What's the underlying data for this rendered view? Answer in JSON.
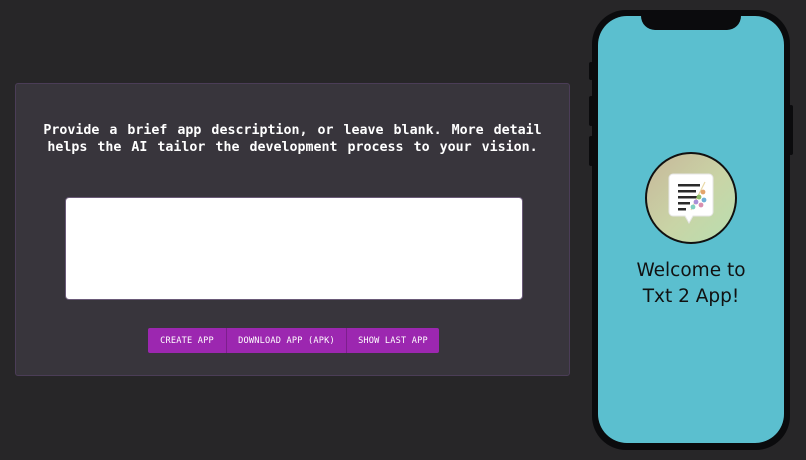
{
  "form": {
    "instructions": "Provide a brief app description, or leave blank. More detail\nhelps the AI tailor the development process to your vision.",
    "description_value": "",
    "description_placeholder": ""
  },
  "buttons": {
    "create": "CREATE APP",
    "download": "DOWNLOAD APP (APK)",
    "show_last": "SHOW LAST APP"
  },
  "phone": {
    "welcome_line1": "Welcome to",
    "welcome_line2": "Txt 2 App!",
    "logo_icon": "document-with-chat-bubble-icon"
  },
  "colors": {
    "background": "#272628",
    "panel": "#38353c",
    "button": "#9c27b0",
    "phone_screen": "#5bbfcf"
  }
}
